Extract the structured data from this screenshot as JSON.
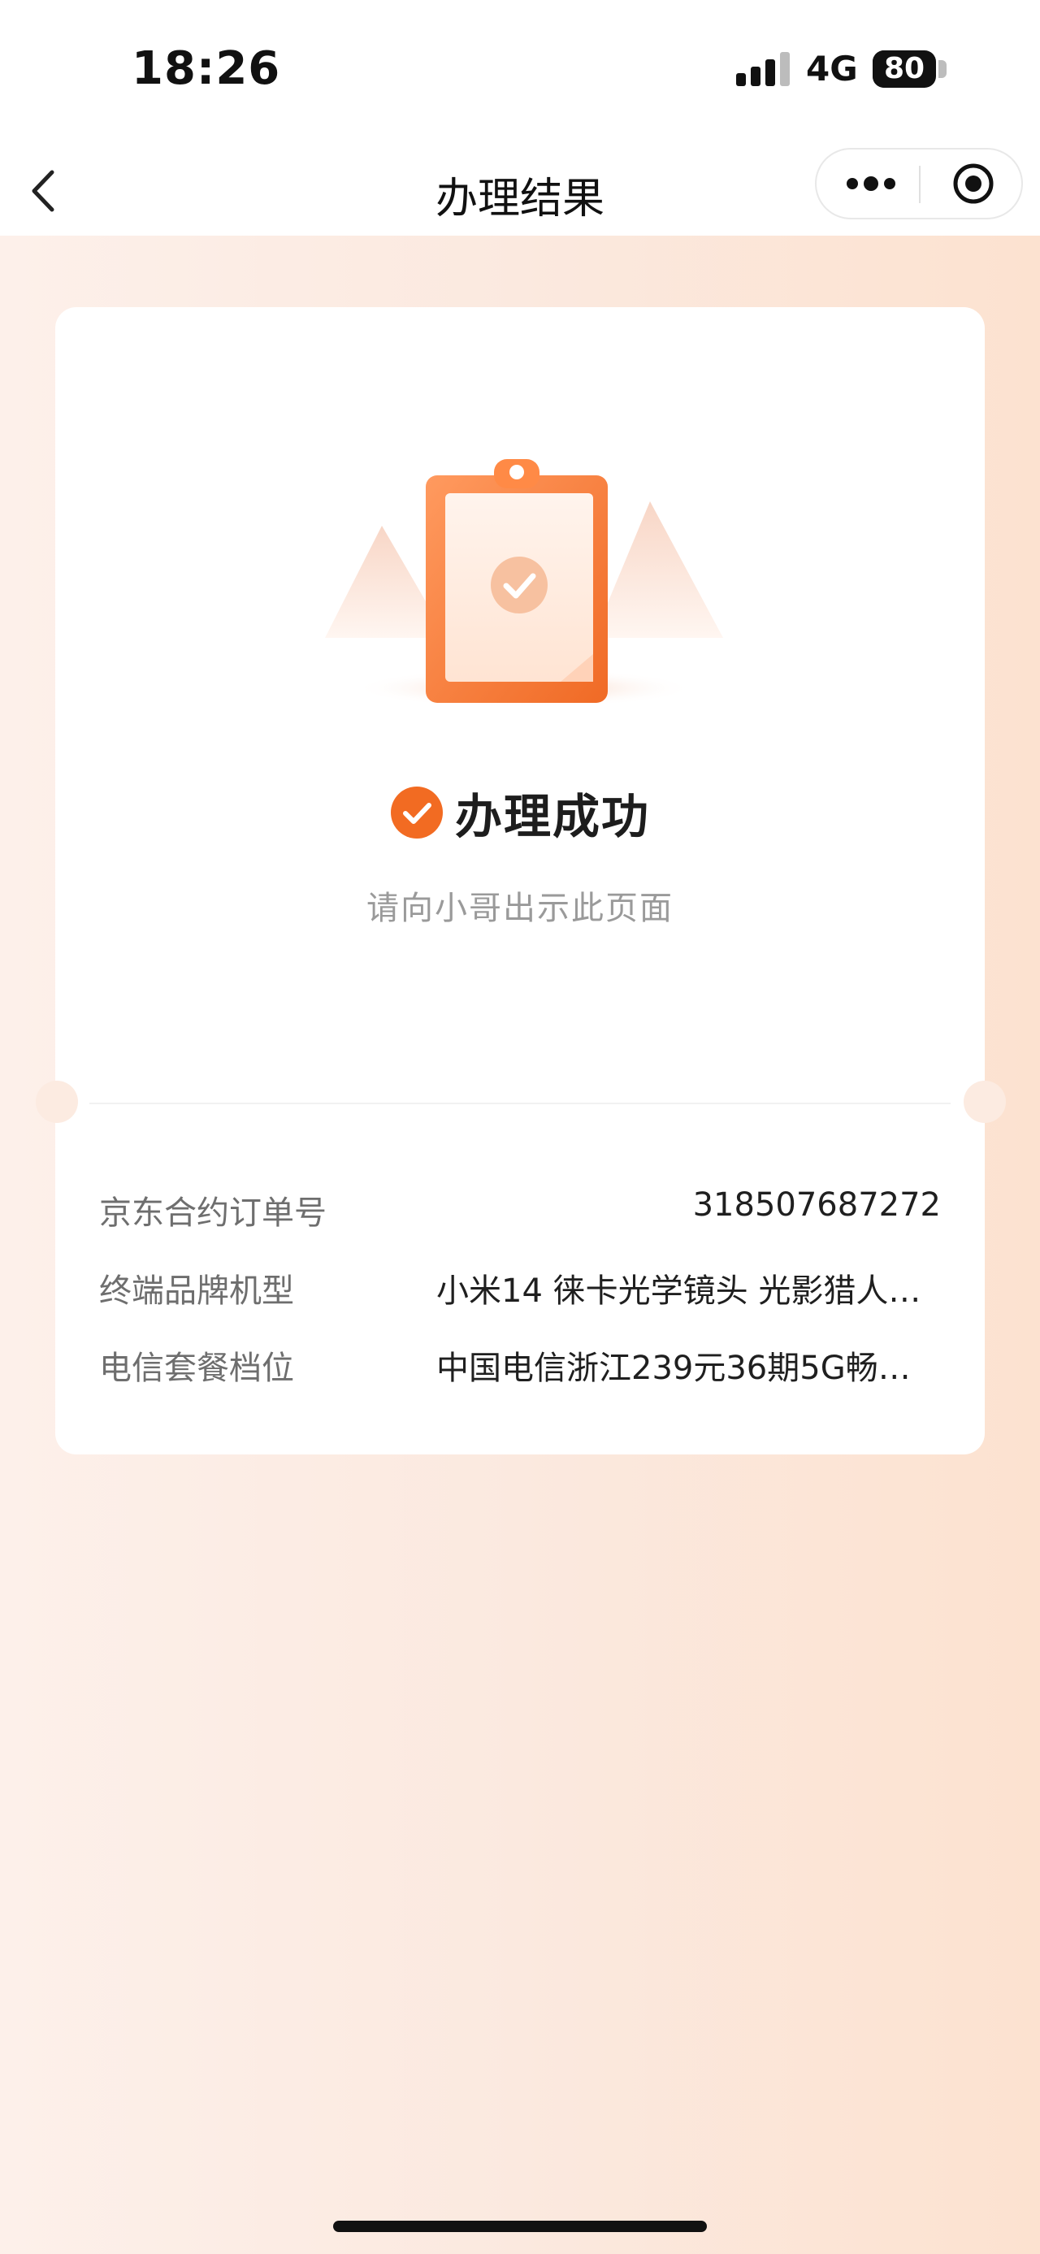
{
  "status_bar": {
    "time": "18:26",
    "network": "4G",
    "battery": "80",
    "battery_level": 0.8,
    "signal_bars": 3
  },
  "nav": {
    "title": "办理结果"
  },
  "result": {
    "status": "办理成功",
    "hint": "请向小哥出示此页面"
  },
  "details": [
    {
      "label": "京东合约订单号",
      "value": "318507687272"
    },
    {
      "label": "终端品牌机型",
      "value": "小米14 徕卡光学镜头 光影猎人…"
    },
    {
      "label": "电信套餐档位",
      "value": "中国电信浙江239元36期5G畅…"
    }
  ],
  "colors": {
    "accent": "#f26b22",
    "background_left": "#fdf0ea",
    "background_right": "#fce2d0"
  },
  "icons": [
    "back-icon",
    "more-icon",
    "close-target-icon",
    "clipboard-check-icon",
    "success-check-icon"
  ]
}
